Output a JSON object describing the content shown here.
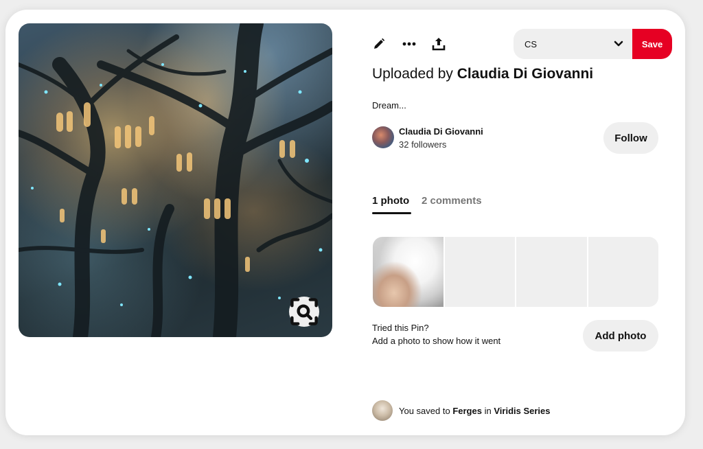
{
  "pin": {
    "image_alt": "Fantasy tree-city illustration",
    "visual_search_icon": "visual-search-icon"
  },
  "toolbar": {
    "edit_icon": "pencil-icon",
    "more_icon": "ellipsis-icon",
    "share_icon": "share-upload-icon",
    "board_selected": "CS",
    "board_dropdown_icon": "chevron-down-icon",
    "save_label": "Save"
  },
  "title": {
    "prefix": "Uploaded by",
    "uploader": "Claudia Di Giovanni"
  },
  "description": "Dream...",
  "creator": {
    "name": "Claudia Di Giovanni",
    "followers": "32 followers",
    "follow_label": "Follow"
  },
  "tabs": [
    {
      "label": "1 photo",
      "active": true
    },
    {
      "label": "2 comments",
      "active": false
    }
  ],
  "tried": {
    "question": "Tried this Pin?",
    "prompt": "Add a photo to show how it went",
    "add_photo_label": "Add photo"
  },
  "saved": {
    "prefix": "You saved to",
    "user": "Ferges",
    "connector": "in",
    "board": "Viridis Series"
  },
  "colors": {
    "accent": "#e60023",
    "button_bg": "#efefef",
    "text": "#111111",
    "muted": "#767676"
  }
}
